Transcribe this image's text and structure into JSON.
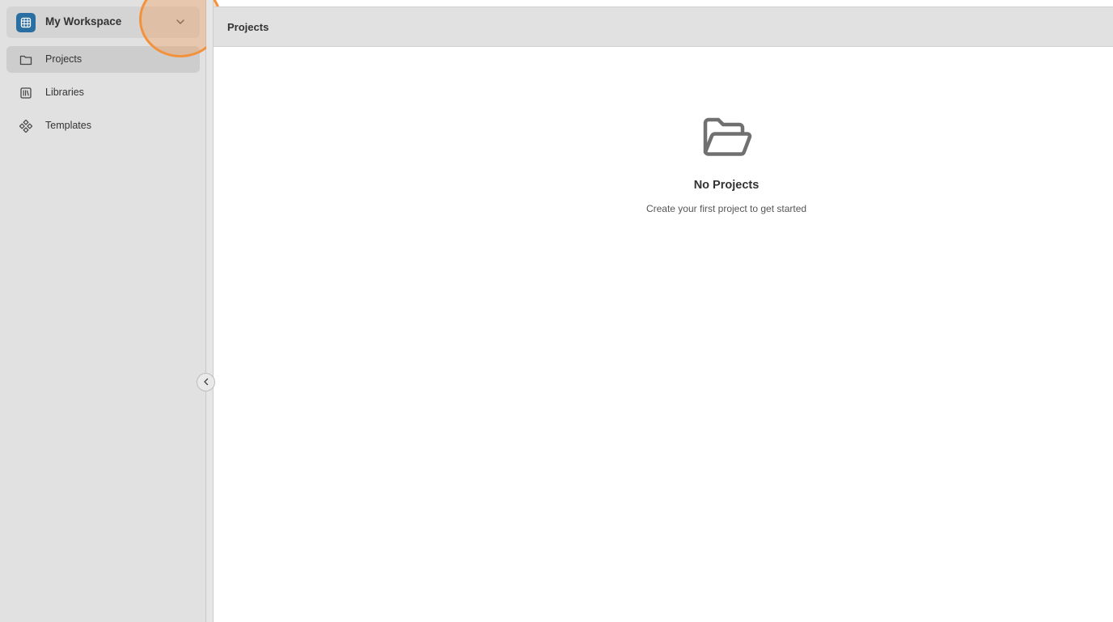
{
  "workspace": {
    "name": "My Workspace",
    "logo_icon": "workspace-logo-icon",
    "chevron_icon": "chevron-down-icon"
  },
  "sidebar": {
    "items": [
      {
        "label": "Projects",
        "icon": "folder-icon",
        "active": true
      },
      {
        "label": "Libraries",
        "icon": "library-icon",
        "active": false
      },
      {
        "label": "Templates",
        "icon": "templates-icon",
        "active": false
      }
    ],
    "collapse_icon": "chevron-left-icon"
  },
  "header": {
    "title": "Projects"
  },
  "empty_state": {
    "icon": "folder-open-icon",
    "title": "No Projects",
    "subtitle": "Create your first project to get started"
  },
  "colors": {
    "sidebar_bg": "#e1e1e1",
    "active_item_bg": "#cdcdcd",
    "workspace_logo": "#2a6fa1",
    "focus_highlight": "#f2923d"
  }
}
